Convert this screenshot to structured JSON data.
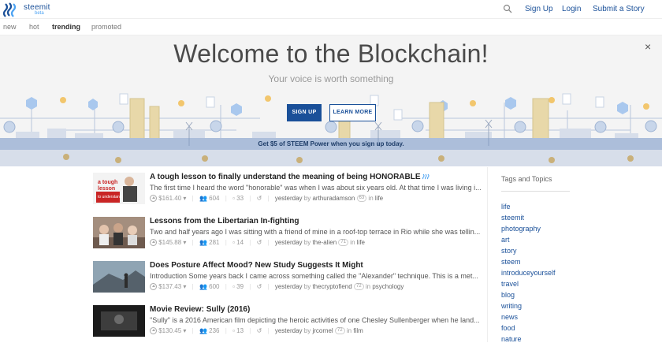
{
  "header": {
    "brand": "steemit",
    "brand_badge": "beta",
    "links": [
      "Sign Up",
      "Login",
      "Submit a Story"
    ]
  },
  "subnav": {
    "items": [
      "new",
      "hot",
      "trending",
      "promoted"
    ],
    "active": "trending"
  },
  "hero": {
    "title": "Welcome to the Blockchain!",
    "subtitle": "Your voice is worth something",
    "signup_label": "SIGN UP",
    "learn_label": "LEARN MORE",
    "close_label": "×",
    "band_text": "Get $5 of STEEM Power when you sign up today.",
    "accent": "#1a5099"
  },
  "posts": [
    {
      "title": "A tough lesson to finally understand the meaning of being HONORABLE",
      "body": "The first time I heard the word \"honorable\" was when I was about six years old. At that time I was living i...",
      "payout": "$161.40",
      "votes": "604",
      "comments": "33",
      "time": "yesterday",
      "by": "by",
      "author": "arthuradamson",
      "rep": "63",
      "in": "in",
      "category": "life",
      "thumb_text": [
        "a tough",
        "lesson",
        "to understand"
      ]
    },
    {
      "title": "Lessons from the Libertarian In-fighting",
      "body": "Two and half years ago I was sitting with a friend of mine in a roof-top terrace in Rio while she was tellin...",
      "payout": "$145.88",
      "votes": "281",
      "comments": "14",
      "time": "yesterday",
      "by": "by",
      "author": "the-alien",
      "rep": "71",
      "in": "in",
      "category": "life"
    },
    {
      "title": "Does Posture Affect Mood? New Study Suggests It Might",
      "body": "Introduction Some years back I came across something called the \"Alexander\" technique. This is a met...",
      "payout": "$137.43",
      "votes": "600",
      "comments": "39",
      "time": "yesterday",
      "by": "by",
      "author": "thecryptofiend",
      "rep": "72",
      "in": "in",
      "category": "psychology"
    },
    {
      "title": "Movie Review: Sully (2016)",
      "body": "\"Sully\" is a 2016 American film depicting the heroic activities of one Chesley Sullenberger when he land...",
      "payout": "$130.45",
      "votes": "236",
      "comments": "13",
      "time": "yesterday",
      "by": "by",
      "author": "jrcornel",
      "rep": "72",
      "in": "in",
      "category": "film"
    }
  ],
  "sidebar": {
    "title": "Tags and Topics",
    "tags": [
      "life",
      "steemit",
      "photography",
      "art",
      "story",
      "steem",
      "introduceyourself",
      "travel",
      "blog",
      "writing",
      "news",
      "food",
      "nature"
    ]
  }
}
